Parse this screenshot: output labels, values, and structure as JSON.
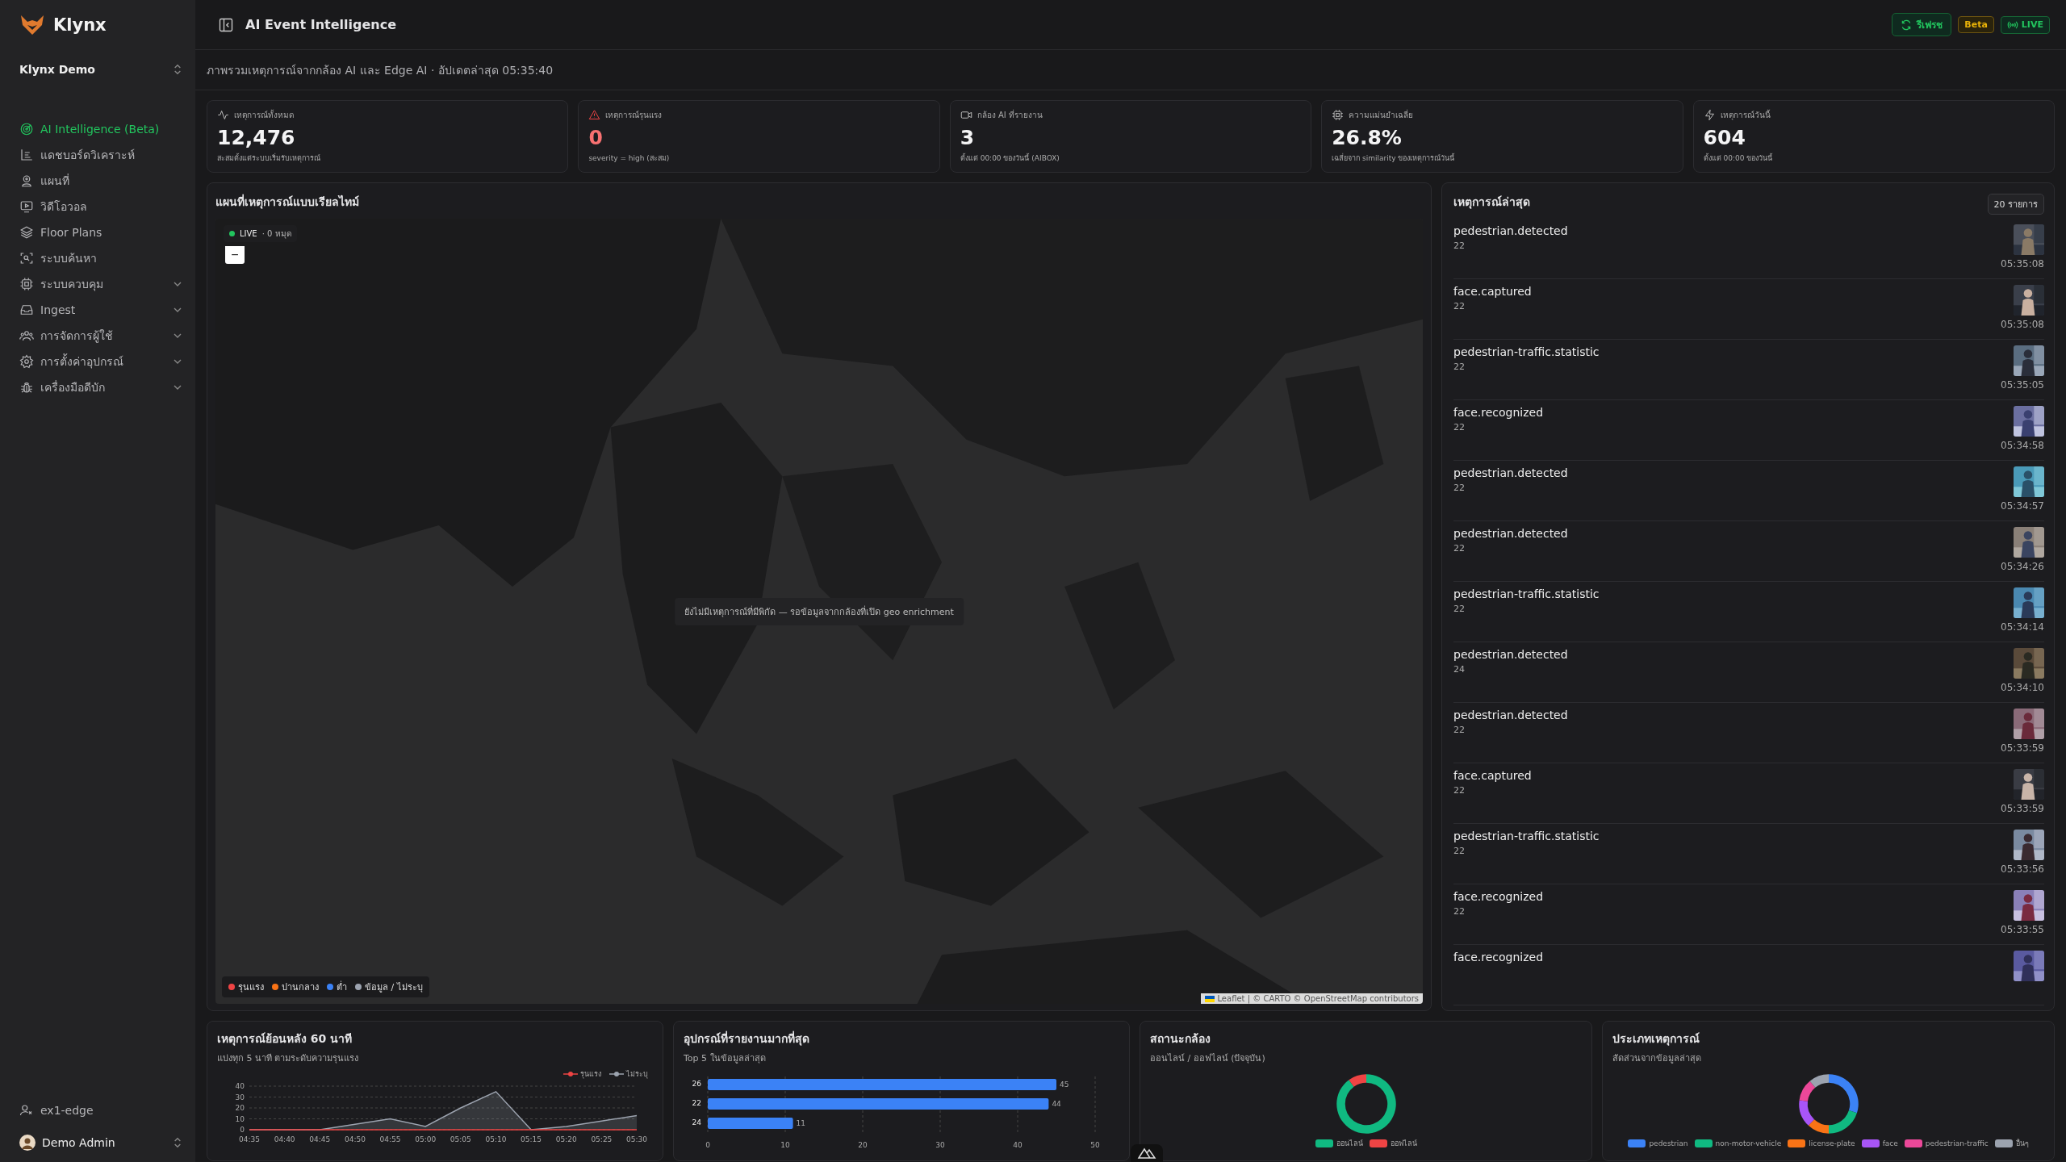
{
  "sidebar": {
    "brand": "Klynx",
    "workspace": "Klynx Demo",
    "items": [
      {
        "label": "AI Intelligence (Beta)",
        "kind": "link",
        "selected": true
      },
      {
        "label": "แดชบอร์ดวิเคราะห์",
        "kind": "link",
        "selected": false
      },
      {
        "label": "แผนที่",
        "kind": "link",
        "selected": false
      },
      {
        "label": "วิดีโอวอล",
        "kind": "link",
        "selected": false
      },
      {
        "label": "Floor Plans",
        "kind": "link",
        "selected": false
      },
      {
        "label": "ระบบค้นหา",
        "kind": "link",
        "selected": false
      },
      {
        "label": "ระบบควบคุม",
        "kind": "group",
        "selected": false
      },
      {
        "label": "Ingest",
        "kind": "group",
        "selected": false
      },
      {
        "label": "การจัดการผู้ใช้",
        "kind": "group",
        "selected": false
      },
      {
        "label": "การตั้งค่าอุปกรณ์",
        "kind": "group",
        "selected": false
      },
      {
        "label": "เครื่องมือดีบัก",
        "kind": "group",
        "selected": false
      }
    ],
    "device": "ex1-edge",
    "user": "Demo Admin"
  },
  "header": {
    "title": "AI Event Intelligence",
    "refresh": "รีเฟรช",
    "badges": [
      {
        "label": "Beta",
        "kind": "beta"
      },
      {
        "label": "LIVE",
        "kind": "live"
      }
    ]
  },
  "subtitle": "ภาพรวมเหตุการณ์จากกล้อง AI และ Edge AI · อัปเดตล่าสุด 05:35:40",
  "stats": [
    {
      "label": "เหตุการณ์ทั้งหมด",
      "value": "12,476",
      "note": "สะสมตั้งแต่ระบบเริ่มรับเหตุการณ์",
      "kind": "normal"
    },
    {
      "label": "เหตุการณ์รุนแรง",
      "value": "0",
      "note": "severity = high (สะสม)",
      "kind": "alert"
    },
    {
      "label": "กล้อง AI ที่รายงาน",
      "value": "3",
      "note": "ตั้งแต่ 00:00 ของวันนี้ (AIBOX)",
      "kind": "normal"
    },
    {
      "label": "ความแม่นยำเฉลี่ย",
      "value": "26.8%",
      "note": "เฉลี่ยจาก similarity ของเหตุการณ์วันนี้",
      "kind": "normal"
    },
    {
      "label": "เหตุการณ์วันนี้",
      "value": "604",
      "note": "ตั้งแต่ 00:00 ของวันนี้",
      "kind": "normal"
    }
  ],
  "map": {
    "title": "แผนที่เหตุการณ์แบบเรียลไทม์",
    "live": "LIVE",
    "pins": "· 0 หมุด",
    "zoom_out": "−",
    "message": "ยังไม่มีเหตุการณ์ที่มีพิกัด — รอข้อมูลจากกล้องที่เปิด geo enrichment",
    "legend": [
      {
        "label": "รุนแรง",
        "color": "#ef4444"
      },
      {
        "label": "ปานกลาง",
        "color": "#f97316"
      },
      {
        "label": "ต่ำ",
        "color": "#3b82f6"
      },
      {
        "label": "ข้อมูล / ไม่ระบุ",
        "color": "#9ca3af"
      }
    ],
    "attribution": "Leaflet | © CARTO © OpenStreetMap contributors"
  },
  "events": {
    "title": "เหตุการณ์ล่าสุด",
    "count": "20 รายการ",
    "items": [
      {
        "type": "pedestrian.detected",
        "source": "22",
        "time": "05:35:08"
      },
      {
        "type": "face.captured",
        "source": "22",
        "time": "05:35:08"
      },
      {
        "type": "pedestrian-traffic.statistic",
        "source": "22",
        "time": "05:35:05"
      },
      {
        "type": "face.recognized",
        "source": "22",
        "time": "05:34:58"
      },
      {
        "type": "pedestrian.detected",
        "source": "22",
        "time": "05:34:57"
      },
      {
        "type": "pedestrian.detected",
        "source": "22",
        "time": "05:34:26"
      },
      {
        "type": "pedestrian-traffic.statistic",
        "source": "22",
        "time": "05:34:14"
      },
      {
        "type": "pedestrian.detected",
        "source": "24",
        "time": "05:34:10"
      },
      {
        "type": "pedestrian.detected",
        "source": "22",
        "time": "05:33:59"
      },
      {
        "type": "face.captured",
        "source": "22",
        "time": "05:33:59"
      },
      {
        "type": "pedestrian-traffic.statistic",
        "source": "22",
        "time": "05:33:56"
      },
      {
        "type": "face.recognized",
        "source": "22",
        "time": "05:33:55"
      },
      {
        "type": "face.recognized"
      }
    ]
  },
  "charts": [
    {
      "title": "เหตุการณ์ย้อนหลัง 60 นาที",
      "subtitle": "แบ่งทุก 5 นาที ตามระดับความรุนแรง",
      "chart_data": {
        "type": "line",
        "x": [
          "04:35",
          "04:40",
          "04:45",
          "04:50",
          "04:55",
          "05:00",
          "05:05",
          "05:10",
          "05:15",
          "05:20",
          "05:25",
          "05:30"
        ],
        "yticks": [
          0,
          10,
          20,
          30,
          40
        ],
        "ylim": [
          0,
          40
        ],
        "grid": true,
        "series": [
          {
            "name": "รุนแรง",
            "color": "#ef4444",
            "values": [
              0,
              0,
              0,
              0,
              0,
              0,
              0,
              0,
              0,
              0,
              0,
              0
            ]
          },
          {
            "name": "ไม่ระบุ",
            "color": "#9ca3af",
            "values": [
              0,
              0,
              0,
              5,
              10,
              3,
              20,
              35,
              0,
              3,
              8,
              13
            ]
          }
        ]
      }
    },
    {
      "title": "อุปกรณ์ที่รายงานมากที่สุด",
      "subtitle": "Top 5 ในข้อมูลล่าสุด",
      "chart_data": {
        "type": "bar",
        "orientation": "horizontal",
        "categories": [
          "26",
          "22",
          "24"
        ],
        "values": [
          45,
          44,
          11
        ],
        "xticks": [
          0,
          10,
          20,
          30,
          40,
          50
        ],
        "xlim": [
          0,
          50
        ],
        "grid": true,
        "data_labels": true
      }
    },
    {
      "title": "สถานะกล้อง",
      "subtitle": "ออนไลน์ / ออฟไลน์ (ปัจจุบัน)",
      "chart_data": {
        "type": "donut",
        "categories": [
          "ออนไลน์",
          "ออฟไลน์"
        ],
        "values": [
          90,
          10
        ],
        "colors": [
          "#10b981",
          "#ef4444"
        ]
      }
    },
    {
      "title": "ประเภทเหตุการณ์",
      "subtitle": "สัดส่วนจากข้อมูลล่าสุด",
      "chart_data": {
        "type": "donut",
        "categories": [
          "pedestrian",
          "non-motor-vehicle",
          "license-plate",
          "face",
          "pedestrian-traffic",
          "อื่นๆ"
        ],
        "values": [
          30,
          20,
          12,
          15,
          12,
          11
        ],
        "colors": [
          "#3b82f6",
          "#10b981",
          "#f97316",
          "#a855f7",
          "#ec4899",
          "#9ca3af"
        ]
      }
    }
  ]
}
